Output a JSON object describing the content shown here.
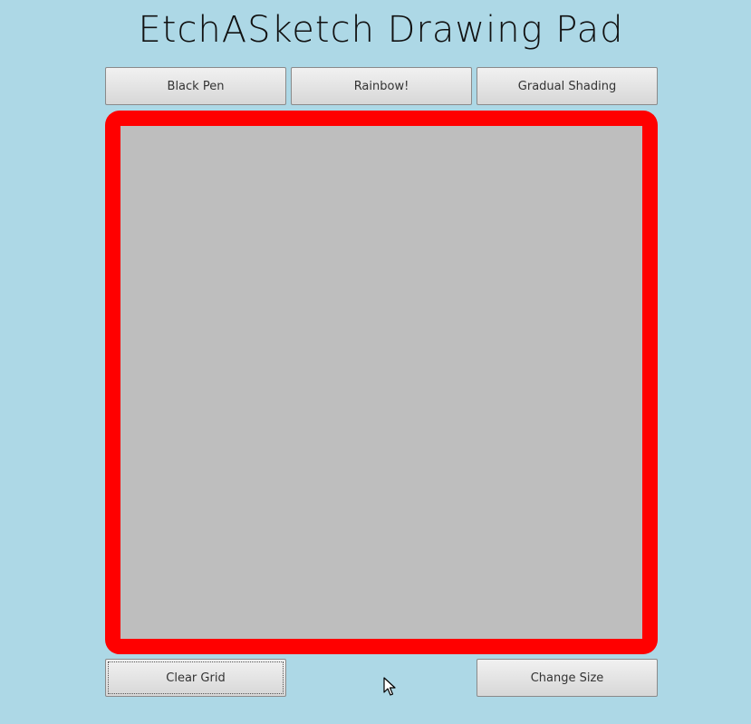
{
  "app": {
    "title": "EtchASketch Drawing Pad"
  },
  "toolbar": {
    "black_pen_label": "Black Pen",
    "rainbow_label": "Rainbow!",
    "shading_label": "Gradual Shading"
  },
  "footer": {
    "clear_label": "Clear Grid",
    "size_label": "Change Size"
  },
  "colors": {
    "background": "#add8e6",
    "frame": "#ff0000",
    "grid": "#bebebe"
  },
  "icons": {
    "cursor": "mouse-pointer-icon"
  }
}
